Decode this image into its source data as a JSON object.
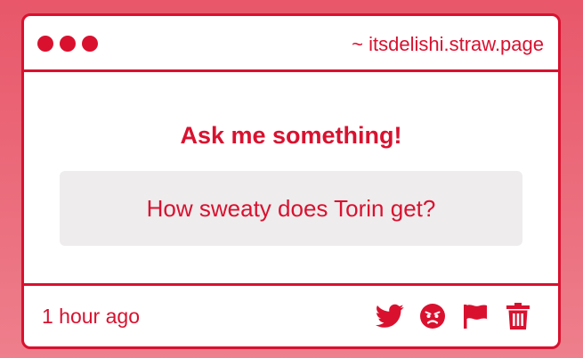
{
  "window": {
    "url": "~ itsdelishi.straw.page"
  },
  "main": {
    "prompt": "Ask me something!",
    "question": "How sweaty does Torin get?"
  },
  "footer": {
    "timestamp": "1 hour ago",
    "actions": [
      {
        "icon": "twitter-icon"
      },
      {
        "icon": "angry-face-icon"
      },
      {
        "icon": "flag-icon"
      },
      {
        "icon": "trash-icon"
      }
    ]
  },
  "colors": {
    "accent": "#d9112f",
    "background_top": "#e8576a",
    "background_bottom": "#ee7f8c",
    "question_box": "#eeeced"
  }
}
